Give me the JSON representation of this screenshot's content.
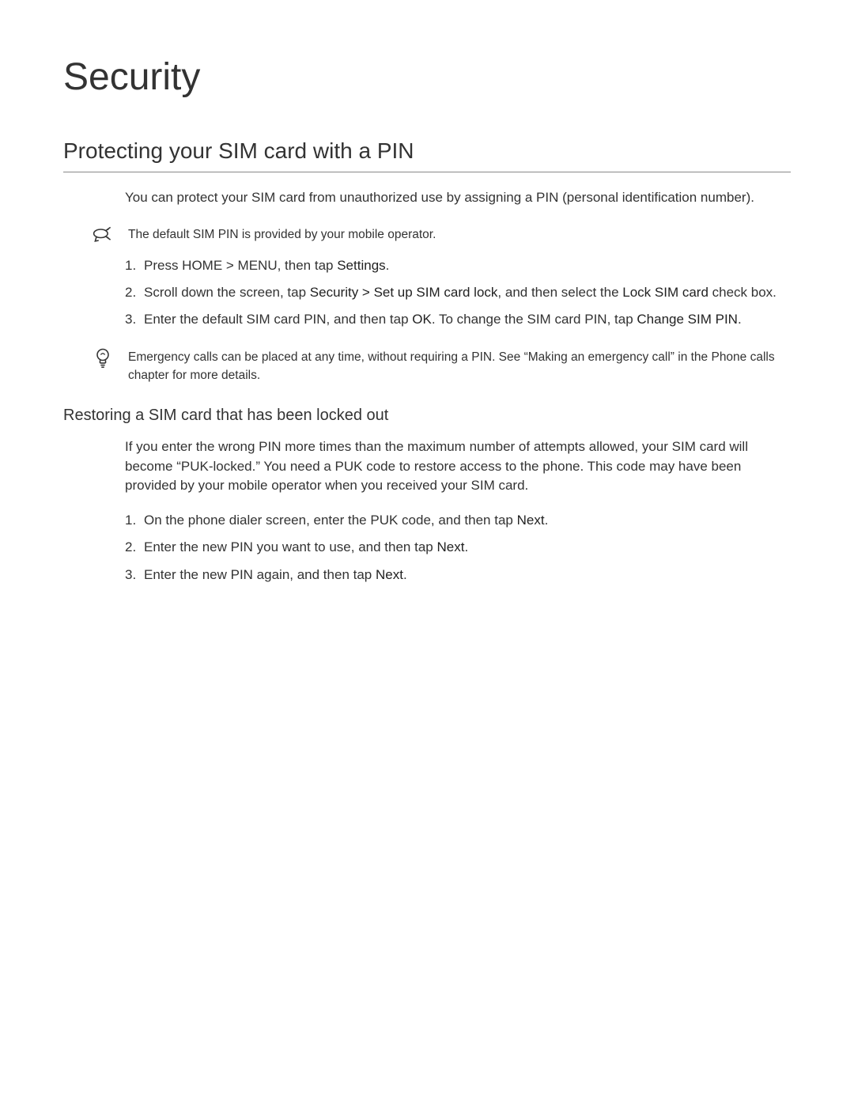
{
  "page": {
    "title": "Security"
  },
  "section1": {
    "heading": "Protecting your SIM card with a PIN",
    "intro": "You can protect your SIM card from unauthorized use by assigning a PIN (personal identification number).",
    "note1": "The default SIM PIN is provided by your mobile operator.",
    "steps": {
      "s1_a": "Press HOME > MENU, then tap ",
      "s1_b": "Settings",
      "s1_c": ".",
      "s2_a": "Scroll down the screen, tap ",
      "s2_b": "Security > Set up SIM card lock",
      "s2_c": ", and then select the ",
      "s2_d": "Lock SIM card",
      "s2_e": " check box.",
      "s3_a": "Enter the default SIM card PIN, and then tap ",
      "s3_b": "OK",
      "s3_c": ". To change the SIM card PIN, tap ",
      "s3_d": "Change SIM PIN",
      "s3_e": "."
    },
    "note2": "Emergency calls can be placed at any time, without requiring a PIN. See “Making an emergency call” in the Phone calls chapter for more details."
  },
  "section2": {
    "heading": "Restoring a SIM card that has been locked out",
    "intro": "If you enter the wrong PIN more times than the maximum number of attempts allowed, your SIM card will become “PUK-locked.” You need a PUK code to restore access to the phone. This code may have been provided by your mobile operator when you received your SIM card.",
    "steps": {
      "s1_a": "On the phone dialer screen, enter the PUK code, and then tap ",
      "s1_b": "Next",
      "s1_c": ".",
      "s2_a": "Enter the new PIN you want to use, and then tap ",
      "s2_b": "Next",
      "s2_c": ".",
      "s3_a": "Enter the new PIN again, and then tap ",
      "s3_b": "Next",
      "s3_c": "."
    }
  },
  "numbers": {
    "n1": "1.",
    "n2": "2.",
    "n3": "3."
  }
}
